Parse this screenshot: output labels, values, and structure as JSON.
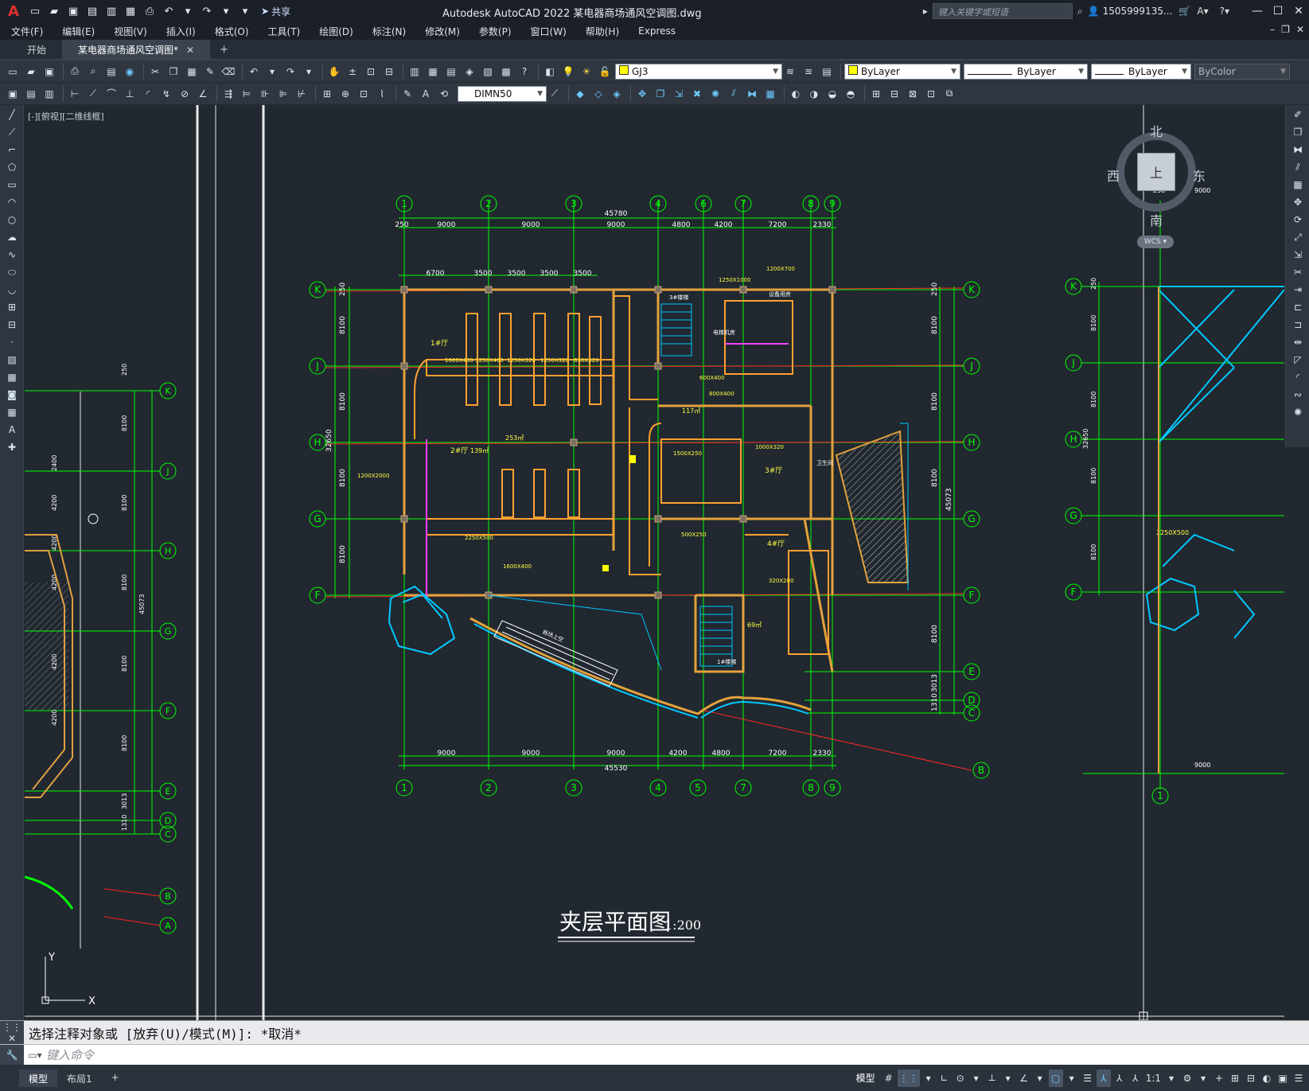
{
  "app": {
    "logo": "A",
    "title": "Autodesk AutoCAD 2022    某电器商场通风空调图.dwg",
    "share_label": "共享",
    "search_placeholder": "键入关键字或短语",
    "user": "1505999135..."
  },
  "menu": {
    "items": [
      "文件(F)",
      "编辑(E)",
      "视图(V)",
      "插入(I)",
      "格式(O)",
      "工具(T)",
      "绘图(D)",
      "标注(N)",
      "修改(M)",
      "参数(P)",
      "窗口(W)",
      "帮助(H)",
      "Express"
    ]
  },
  "tabs": {
    "start": "开始",
    "active": "某电器商场通风空调图*",
    "close": "✕",
    "add": "+"
  },
  "toolbar": {
    "layer": "GJ3",
    "color": "ByLayer",
    "linetype": "ByLayer",
    "lineweight": "ByLayer",
    "plotstyle": "ByColor",
    "dimstyle": "DIMN50"
  },
  "viewport": {
    "label": "[-][俯视][二维线框]"
  },
  "viewcube": {
    "north": "北",
    "south": "南",
    "east": "东",
    "west": "西",
    "top": "上",
    "wcs": "WCS"
  },
  "drawing": {
    "title": "夹层平面图",
    "scale": "1:200",
    "col_labels_top": [
      "1",
      "2",
      "3",
      "4",
      "6",
      "7",
      "8",
      "9"
    ],
    "col_labels_bottom": [
      "1",
      "2",
      "3",
      "4",
      "5",
      "7",
      "8",
      "9"
    ],
    "row_labels_right": [
      "K",
      "J",
      "H",
      "G",
      "F",
      "E",
      "D",
      "C",
      "B"
    ],
    "row_labels_left": [
      "K",
      "J",
      "H",
      "G",
      "F"
    ],
    "dims_top": [
      "250",
      "9000",
      "9000",
      "9000",
      "4800",
      "4200",
      "7200",
      "2330"
    ],
    "dims_bottom": [
      "9000",
      "9000",
      "9000",
      "4200",
      "4800",
      "7200",
      "2330"
    ],
    "total_top": "45780",
    "total_bottom": "45530",
    "dims_second": [
      "6700",
      "3500",
      "3500",
      "3500",
      "3500"
    ],
    "dims_left": [
      "250",
      "8100",
      "8100",
      "8100",
      "8100"
    ],
    "total_left": "32650",
    "dims_right": [
      "250",
      "8100",
      "8100",
      "8100",
      "8100",
      "3013",
      "1310"
    ],
    "total_right": "45073",
    "rooms": [
      "1#厅",
      "2#厅",
      "3#厅",
      "4#厅",
      "3#楼梯",
      "1#楼梯",
      "电梯机房",
      "设备用房",
      "卫生间",
      "商场上空"
    ],
    "ducts": [
      "1600X400",
      "1250X400",
      "1250X320",
      "1250X320",
      "630X320",
      "800X400",
      "600X400",
      "1000X320",
      "500X250",
      "320X200",
      "1200X2000",
      "1500X250",
      "1250X1000",
      "1200X700",
      "2250X500",
      "1600X400"
    ],
    "areas": [
      "253㎡",
      "139㎡",
      "117㎡",
      "69㎡"
    ],
    "neighbor_left_labels": [
      "K",
      "J",
      "H",
      "G",
      "F",
      "E",
      "D",
      "C",
      "B",
      "A"
    ],
    "neighbor_right_labels": [
      "K",
      "J",
      "H",
      "G",
      "F"
    ],
    "neighbor_left_dims": [
      "250",
      "8100",
      "8100",
      "8100",
      "8100",
      "8100",
      "3013",
      "1310",
      "45073"
    ],
    "neighbor_left_col_dims": [
      "2400",
      "4200",
      "4200",
      "4200",
      "4200",
      "4200"
    ],
    "neighbor_right_dims": [
      "250",
      "8100",
      "8100",
      "8100",
      "8100",
      "32650"
    ],
    "neighbor_right_top": [
      "250",
      "9000"
    ],
    "neighbor_right_bottom": "9000",
    "neighbor_right_col": "1",
    "neighbor_right_duct": "2250X500",
    "ucs_x": "X",
    "ucs_y": "Y"
  },
  "command": {
    "history": "选择注释对象或 [放弃(U)/模式(M)]: *取消*",
    "placeholder": "键入命令"
  },
  "layouts": {
    "model": "模型",
    "layout1": "布局1",
    "add": "+"
  },
  "status": {
    "model": "模型",
    "scale": "1:1"
  }
}
